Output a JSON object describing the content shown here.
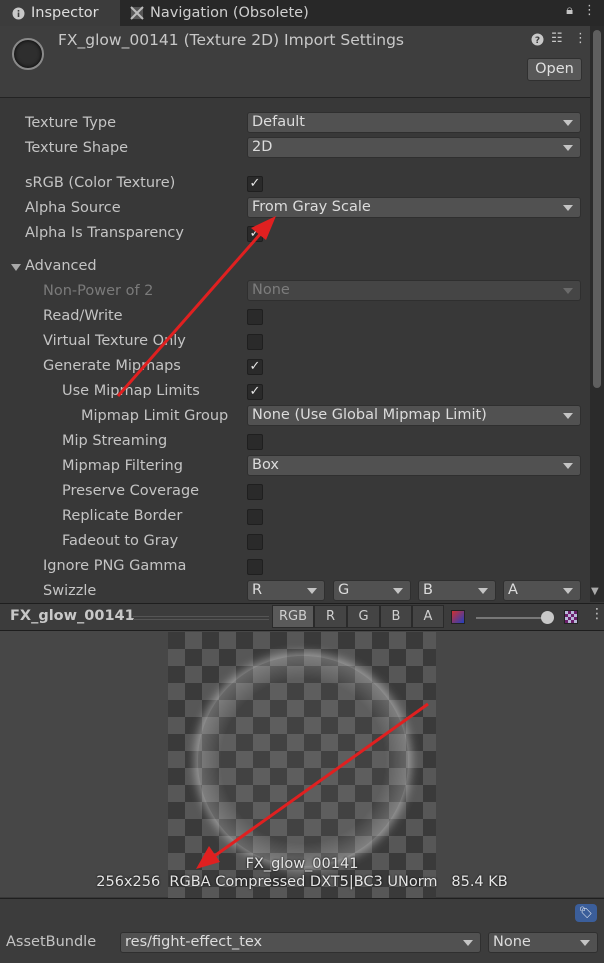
{
  "tabs": [
    {
      "label": "Inspector",
      "icon": "info-icon",
      "active": true
    },
    {
      "label": "Navigation (Obsolete)",
      "icon": "navigation-icon",
      "active": false
    }
  ],
  "header": {
    "title": "FX_glow_00141 (Texture 2D) Import Settings",
    "open_label": "Open"
  },
  "properties": {
    "texture_type": {
      "label": "Texture Type",
      "value": "Default"
    },
    "texture_shape": {
      "label": "Texture Shape",
      "value": "2D"
    },
    "srgb": {
      "label": "sRGB (Color Texture)",
      "checked": true
    },
    "alpha_source": {
      "label": "Alpha Source",
      "value": "From Gray Scale"
    },
    "alpha_is_transparency": {
      "label": "Alpha Is Transparency",
      "checked": true
    },
    "advanced": {
      "label": "Advanced",
      "expanded": true
    },
    "non_power_of_2": {
      "label": "Non-Power of 2",
      "value": "None",
      "disabled": true
    },
    "read_write": {
      "label": "Read/Write",
      "checked": false
    },
    "virtual_texture_only": {
      "label": "Virtual Texture Only",
      "checked": false
    },
    "generate_mipmaps": {
      "label": "Generate Mipmaps",
      "checked": true
    },
    "use_mipmap_limits": {
      "label": "Use Mipmap Limits",
      "checked": true
    },
    "mipmap_limit_group": {
      "label": "Mipmap Limit Group",
      "value": "None (Use Global Mipmap Limit)"
    },
    "mip_streaming": {
      "label": "Mip Streaming",
      "checked": false
    },
    "mipmap_filtering": {
      "label": "Mipmap Filtering",
      "value": "Box"
    },
    "preserve_coverage": {
      "label": "Preserve Coverage",
      "checked": false
    },
    "replicate_border": {
      "label": "Replicate Border",
      "checked": false
    },
    "fadeout_to_gray": {
      "label": "Fadeout to Gray",
      "checked": false
    },
    "ignore_png_gamma": {
      "label": "Ignore PNG Gamma",
      "checked": false
    },
    "swizzle": {
      "label": "Swizzle",
      "values": [
        "R",
        "G",
        "B",
        "A"
      ]
    }
  },
  "preview": {
    "name": "FX_glow_00141",
    "channels": [
      "RGB",
      "R",
      "G",
      "B",
      "A"
    ],
    "active_channel": "RGB",
    "texture_name": "FX_glow_00141",
    "texture_info": "256x256  RGBA Compressed DXT5|BC3 UNorm   85.4 KB"
  },
  "asset_bundle": {
    "label": "AssetBundle",
    "name": "res/fight-effect_tex",
    "variant": "None"
  },
  "colors": {
    "panel_bg": "#383838",
    "annotation_arrow": "#e02020",
    "tag_icon": "#3b5e9a"
  }
}
